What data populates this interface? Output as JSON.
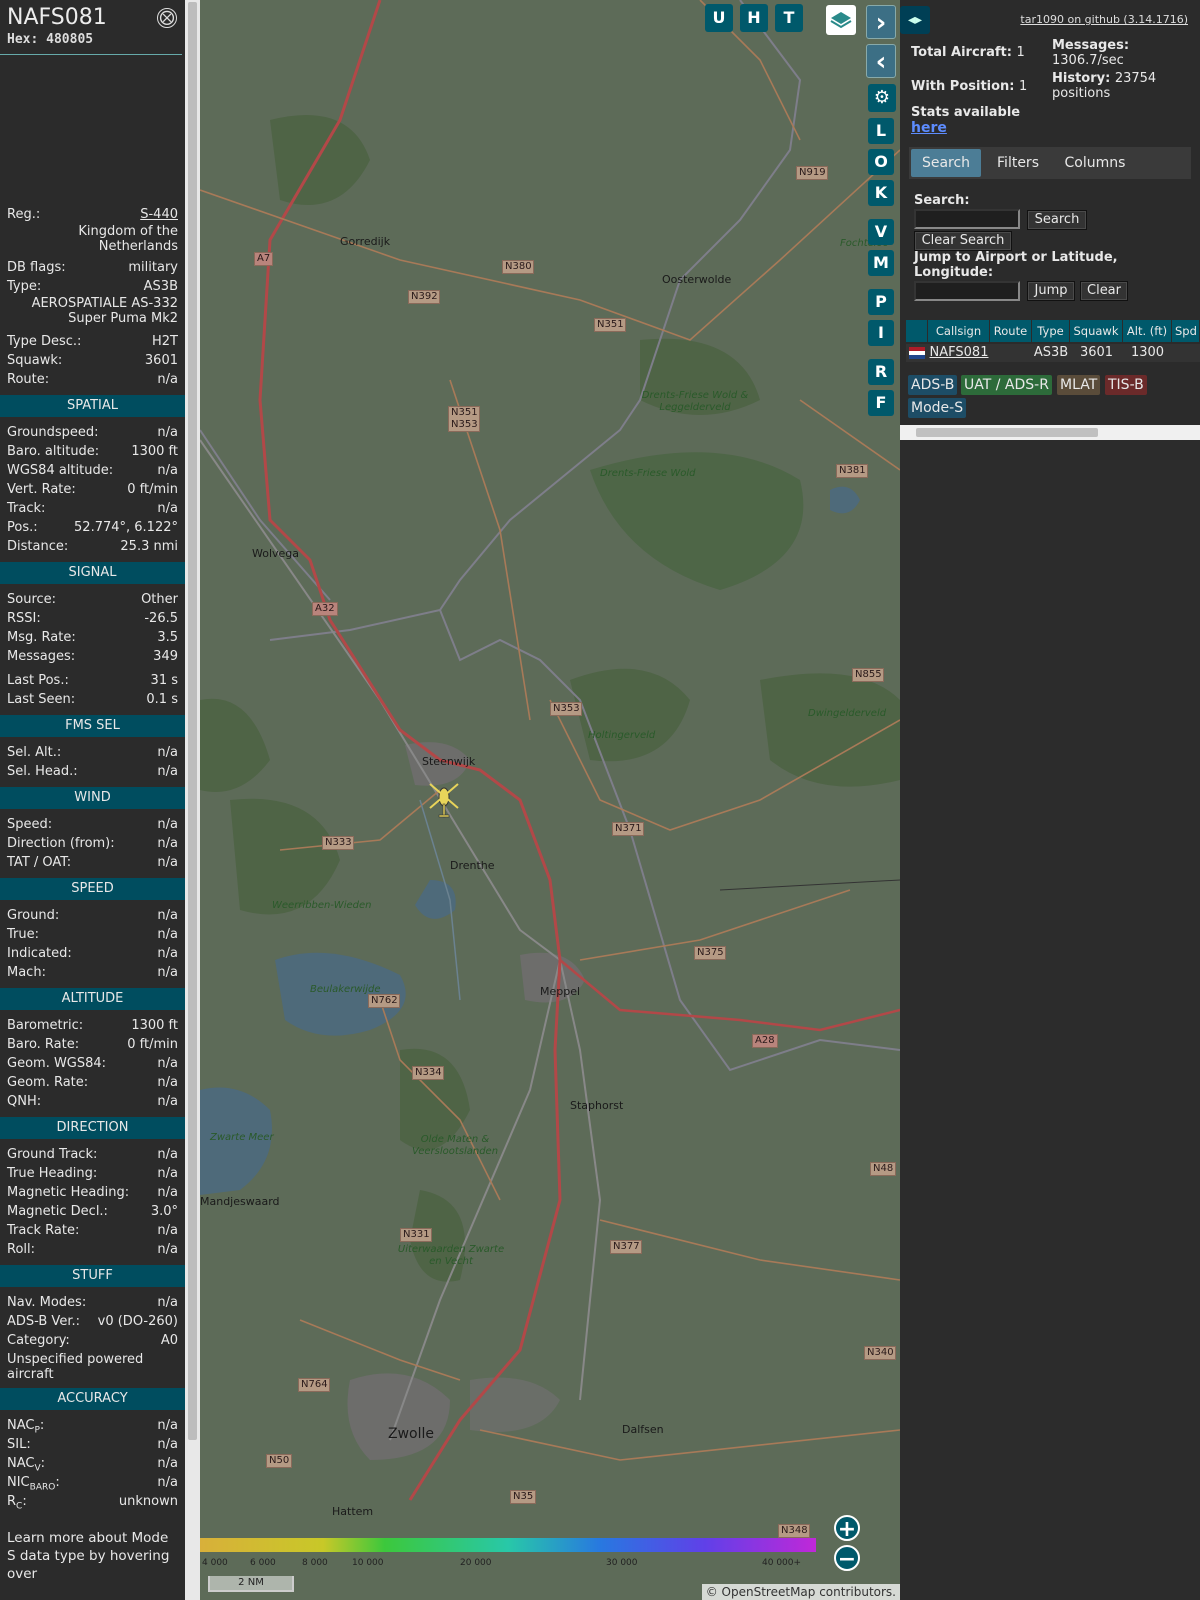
{
  "info": {
    "callsign": "NAFS081",
    "hex": "Hex: 480805",
    "close_glyph": "⨂",
    "rows_top": [
      {
        "label": "Reg.:",
        "value": "S-440"
      },
      {
        "label": "",
        "value": "Kingdom of the Netherlands"
      },
      {
        "label": "DB flags:",
        "value": "military"
      },
      {
        "label": "Type:",
        "value": "AS3B"
      },
      {
        "label": "",
        "value": "AEROSPATIALE AS-332 Super Puma Mk2"
      },
      {
        "label": "Type Desc.:",
        "value": "H2T"
      },
      {
        "label": "Squawk:",
        "value": "3601"
      },
      {
        "label": "Route:",
        "value": "n/a"
      }
    ],
    "sections": [
      {
        "title": "SPATIAL",
        "rows": [
          {
            "label": "Groundspeed:",
            "value": "n/a"
          },
          {
            "label": "Baro. altitude:",
            "value": "1300 ft"
          },
          {
            "label": "WGS84 altitude:",
            "value": "n/a"
          },
          {
            "label": "Vert. Rate:",
            "value": "0 ft/min"
          },
          {
            "label": "Track:",
            "value": "n/a"
          },
          {
            "label": "Pos.:",
            "value": "52.774°, 6.122°"
          },
          {
            "label": "Distance:",
            "value": "25.3 nmi"
          }
        ]
      },
      {
        "title": "SIGNAL",
        "rows": [
          {
            "label": "Source:",
            "value": "Other"
          },
          {
            "label": "RSSI:",
            "value": "-26.5"
          },
          {
            "label": "Msg. Rate:",
            "value": "3.5"
          },
          {
            "label": "Messages:",
            "value": "349"
          },
          {
            "label": "Last Pos.:",
            "value": "31 s"
          },
          {
            "label": "Last Seen:",
            "value": "0.1 s"
          }
        ]
      },
      {
        "title": "FMS SEL",
        "rows": [
          {
            "label": "Sel. Alt.:",
            "value": "n/a"
          },
          {
            "label": "Sel. Head.:",
            "value": "n/a"
          }
        ]
      },
      {
        "title": "WIND",
        "rows": [
          {
            "label": "Speed:",
            "value": "n/a"
          },
          {
            "label": "Direction (from):",
            "value": "n/a"
          },
          {
            "label": "TAT / OAT:",
            "value": "n/a"
          }
        ]
      },
      {
        "title": "SPEED",
        "rows": [
          {
            "label": "Ground:",
            "value": "n/a"
          },
          {
            "label": "True:",
            "value": "n/a"
          },
          {
            "label": "Indicated:",
            "value": "n/a"
          },
          {
            "label": "Mach:",
            "value": "n/a"
          }
        ]
      },
      {
        "title": "ALTITUDE",
        "rows": [
          {
            "label": "Barometric:",
            "value": "1300 ft"
          },
          {
            "label": "Baro. Rate:",
            "value": "0 ft/min"
          },
          {
            "label": "Geom. WGS84:",
            "value": "n/a"
          },
          {
            "label": "Geom. Rate:",
            "value": "n/a"
          },
          {
            "label": "QNH:",
            "value": "n/a"
          }
        ]
      },
      {
        "title": "DIRECTION",
        "rows": [
          {
            "label": "Ground Track:",
            "value": "n/a"
          },
          {
            "label": "True Heading:",
            "value": "n/a"
          },
          {
            "label": "Magnetic Heading:",
            "value": "n/a"
          },
          {
            "label": "Magnetic Decl.:",
            "value": "3.0°"
          },
          {
            "label": "Track Rate:",
            "value": "n/a"
          },
          {
            "label": "Roll:",
            "value": "n/a"
          }
        ]
      },
      {
        "title": "STUFF",
        "rows": [
          {
            "label": "Nav. Modes:",
            "value": "n/a"
          },
          {
            "label": "ADS-B Ver.:",
            "value": "v0 (DO-260)"
          },
          {
            "label": "Category:",
            "value": "A0"
          }
        ],
        "note": "Unspecified powered aircraft"
      },
      {
        "title": "ACCURACY",
        "rows": [
          {
            "label": "NACP:",
            "value": "n/a"
          },
          {
            "label": "SIL:",
            "value": "n/a"
          },
          {
            "label": "NACV:",
            "value": "n/a"
          },
          {
            "label": "NICBARO:",
            "value": "n/a"
          },
          {
            "label": "RC:",
            "value": "unknown"
          }
        ]
      }
    ],
    "learn_more": "Learn more about Mode S data type by hovering over"
  },
  "map": {
    "buttons_top": [
      "U",
      "H",
      "T"
    ],
    "buttons_side": [
      "L",
      "O",
      "K",
      "V",
      "M",
      "P",
      "I",
      "R",
      "F"
    ],
    "nav_next": "›",
    "nav_prev": "‹",
    "settings_glyph": "⚙",
    "zoom_in": "+",
    "zoom_out": "−",
    "attribution": "© OpenStreetMap contributors.",
    "scale": "2 NM",
    "altitude_ticks": [
      "4 000",
      "6 000",
      "8 000",
      "10 000",
      "20 000",
      "30 000",
      "40 000+"
    ],
    "place_names": [
      "Gorredijk",
      "Oosterwolde",
      "Wolvega",
      "Steenwijk",
      "Meppel",
      "Staphorst",
      "Zwolle",
      "Dalfsen",
      "Hattem",
      "Mandjeswaard",
      "Zwarte Meer",
      "Beulakerwijde",
      "Weerribben-Wieden",
      "Drents-Friese Wold",
      "Holtingerveld",
      "Dwingelderveld",
      "Olde Maten & Veerslootslanden",
      "Uiterwaarden Zwarte en Vecht",
      "Drents-Friese Wold & Leggelderveld",
      "Drenthe",
      "Fochteloo"
    ],
    "road_labels": [
      "A7",
      "N380",
      "N392",
      "N351",
      "N351 N353",
      "N381",
      "A32",
      "N353",
      "N855",
      "N371",
      "N333",
      "N375",
      "N762",
      "A28",
      "N334",
      "N48",
      "N331",
      "N377",
      "N340",
      "N764",
      "N50",
      "N35",
      "N348",
      "N919"
    ],
    "aircraft_icon": "helicopter-icon"
  },
  "sidebar": {
    "toggle": "◂▸",
    "github": "tar1090 on github (3.14.1716)",
    "total_aircraft_label": "Total Aircraft:",
    "total_aircraft": "1",
    "with_position_label": "With Position:",
    "with_position": "1",
    "messages_label": "Messages:",
    "messages": "1306.7/sec",
    "history_label": "History:",
    "history": "23754 positions",
    "stats_label": "Stats available",
    "stats_link": "here",
    "tabs": [
      "Search",
      "Filters",
      "Columns"
    ],
    "search_label": "Search:",
    "search_button": "Search",
    "clear_search_button": "Clear Search",
    "jump_label": "Jump to Airport or Latitude, Longitude:",
    "jump_button": "Jump",
    "clear_button": "Clear",
    "columns": [
      "",
      "Callsign",
      "Route",
      "Type",
      "Squawk",
      "Alt. (ft)",
      "Spd"
    ],
    "aircraft_row": {
      "callsign": "NAFS081",
      "route": "",
      "type": "AS3B",
      "squawk": "3601",
      "altitude": "1300"
    },
    "badges": [
      {
        "label": "ADS-B",
        "color": "#1d4d66"
      },
      {
        "label": "UAT / ADS-R",
        "color": "#2d6b3a"
      },
      {
        "label": "MLAT",
        "color": "#5a4c3a"
      },
      {
        "label": "TIS-B",
        "color": "#6b2a2a"
      },
      {
        "label": "Mode-S",
        "color": "#1d4d66"
      }
    ]
  }
}
